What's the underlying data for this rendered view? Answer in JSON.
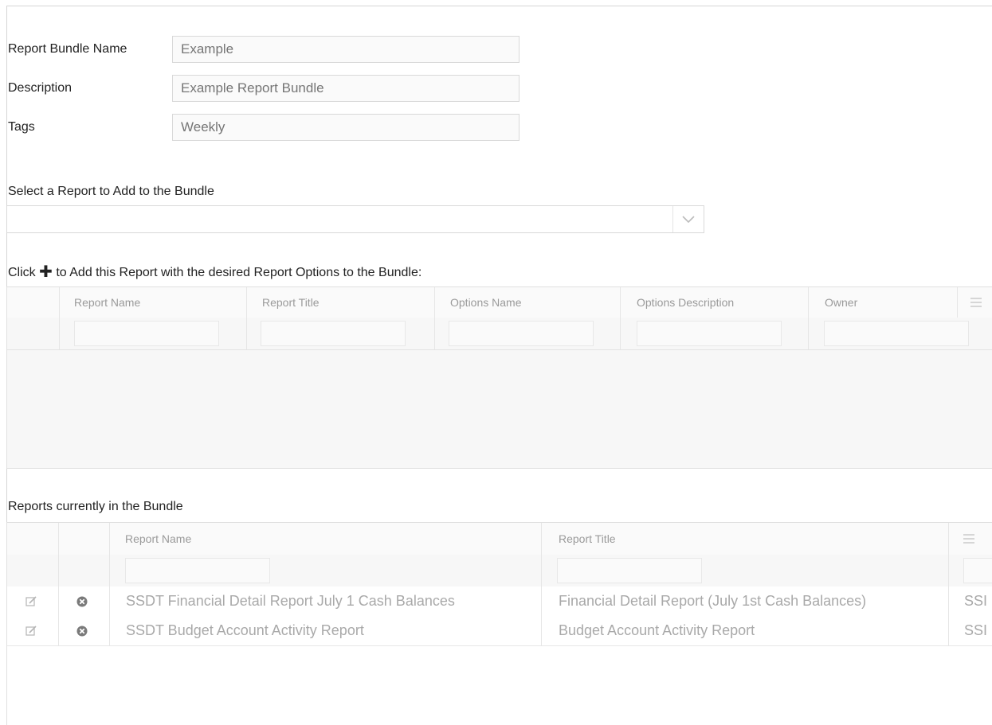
{
  "form": {
    "bundle_name_label": "Report Bundle Name",
    "bundle_name_value": "Example",
    "description_label": "Description",
    "description_value": "Example Report Bundle",
    "tags_label": "Tags",
    "tags_value": "Weekly"
  },
  "select_report": {
    "label": "Select a Report to Add to the Bundle",
    "selected_value": ""
  },
  "add_instruction": {
    "prefix": "Click",
    "plus_glyph": "✚",
    "suffix": "to Add this Report with the desired Report Options to the Bundle:"
  },
  "options_grid": {
    "columns": [
      "Report Name",
      "Report Title",
      "Options Name",
      "Options Description",
      "Owner"
    ],
    "rows": []
  },
  "bundle_grid": {
    "label": "Reports currently in the Bundle",
    "columns": [
      "Report Name",
      "Report Title"
    ],
    "rows": [
      {
        "report_name": "SSDT Financial Detail Report July 1 Cash Balances",
        "report_title": "Financial Detail Report (July 1st Cash Balances)",
        "overflow": "SSI"
      },
      {
        "report_name": "SSDT Budget Account Activity Report",
        "report_title": "Budget Account Activity Report",
        "overflow": "SSI"
      }
    ]
  },
  "icons": {
    "edit": "edit-icon",
    "remove": "remove-circle-icon",
    "column_menu": "hamburger-menu-icon",
    "dropdown": "chevron-down-icon"
  }
}
